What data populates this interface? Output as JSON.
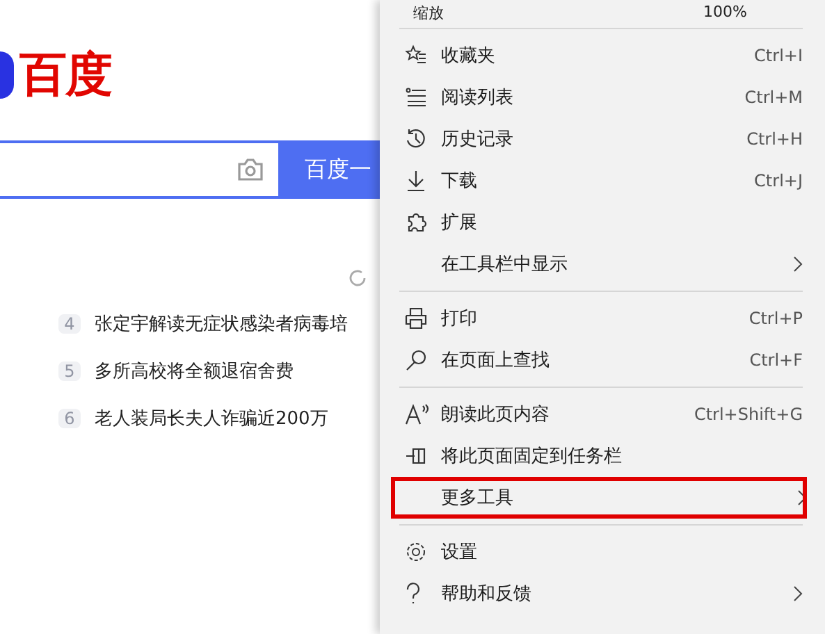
{
  "page": {
    "logo_text": "百度",
    "search": {
      "button": "百度一"
    },
    "hot_list": [
      {
        "rank": "4",
        "title": "张定宇解读无症状感染者病毒培"
      },
      {
        "rank": "5",
        "title": "多所高校将全额退宿舍费"
      },
      {
        "rank": "6",
        "title": "老人装局长夫人诈骗近200万"
      }
    ]
  },
  "menu": {
    "zoom": {
      "label": "缩放",
      "value": "100%"
    },
    "groups": [
      [
        {
          "label": "收藏夹",
          "shortcut": "Ctrl+I",
          "submenu": false,
          "outlined": false
        },
        {
          "label": "阅读列表",
          "shortcut": "Ctrl+M",
          "submenu": false,
          "outlined": false
        },
        {
          "label": "历史记录",
          "shortcut": "Ctrl+H",
          "submenu": false,
          "outlined": false
        },
        {
          "label": "下载",
          "shortcut": "Ctrl+J",
          "submenu": false,
          "outlined": false
        },
        {
          "label": "扩展",
          "submenu": false,
          "outlined": false
        },
        {
          "label": "在工具栏中显示",
          "submenu": true,
          "outlined": false
        }
      ],
      [
        {
          "label": "打印",
          "shortcut": "Ctrl+P",
          "submenu": false,
          "outlined": false
        },
        {
          "label": "在页面上查找",
          "shortcut": "Ctrl+F",
          "submenu": false,
          "outlined": false
        }
      ],
      [
        {
          "label": "朗读此页内容",
          "shortcut": "Ctrl+Shift+G",
          "submenu": false,
          "outlined": false
        },
        {
          "label": "将此页面固定到任务栏",
          "submenu": false,
          "outlined": false
        },
        {
          "label": "更多工具",
          "submenu": true,
          "outlined": true
        }
      ],
      [
        {
          "label": "设置",
          "submenu": false,
          "outlined": false
        },
        {
          "label": "帮助和反馈",
          "submenu": true,
          "outlined": false
        }
      ]
    ]
  }
}
